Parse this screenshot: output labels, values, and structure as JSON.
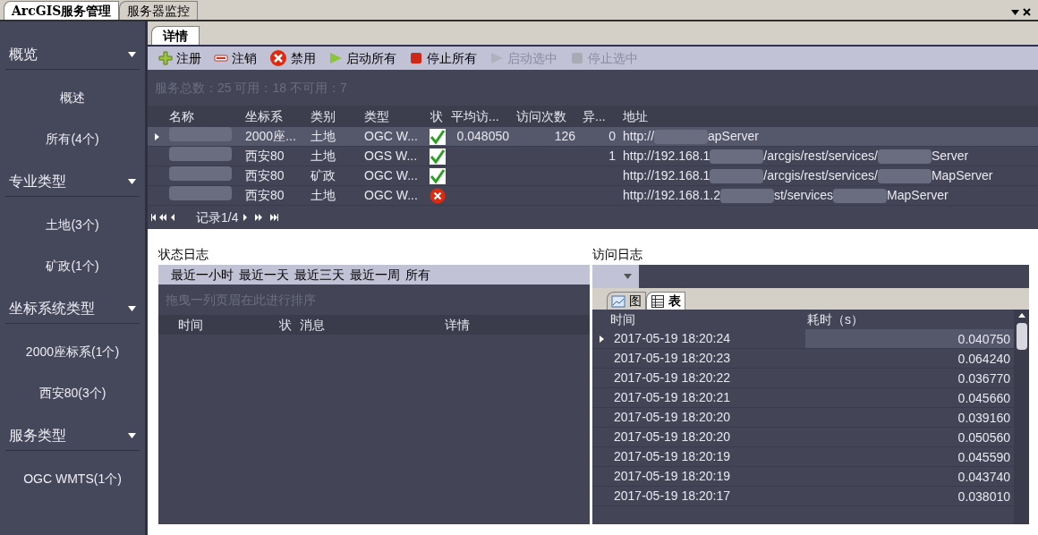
{
  "top_tabs": [
    {
      "label": "ArcGIS服务管理",
      "selected": true
    },
    {
      "label": "服务器监控",
      "selected": false
    }
  ],
  "sidebar": {
    "groups": [
      {
        "title": "概览",
        "items": [
          "概述",
          "所有(4个)"
        ]
      },
      {
        "title": "专业类型",
        "items": [
          "土地(3个)",
          "矿政(1个)"
        ]
      },
      {
        "title": "坐标系统类型",
        "items": [
          "2000座标系(1个)",
          "西安80(3个)"
        ]
      },
      {
        "title": "服务类型",
        "items": [
          "OGC WMTS(1个)"
        ]
      }
    ]
  },
  "detail_tab": {
    "label": "详情",
    "selected": true
  },
  "toolbar": [
    {
      "kind": "register",
      "label": "注册",
      "disabled": false
    },
    {
      "kind": "unregister",
      "label": "注销",
      "disabled": false
    },
    {
      "kind": "disable",
      "label": "禁用",
      "disabled": false
    },
    {
      "kind": "start",
      "label": "启动所有",
      "disabled": false
    },
    {
      "kind": "stop",
      "label": "停止所有",
      "disabled": false
    },
    {
      "kind": "start",
      "label": "启动选中",
      "disabled": true
    },
    {
      "kind": "stop",
      "label": "停止选中",
      "disabled": true
    }
  ],
  "summary": "服务总数：25 可用：18 不可用：7",
  "grid": {
    "columns": [
      "名称",
      "坐标系",
      "类别",
      "类型",
      "状",
      "平均访...",
      "访问次数",
      "异...",
      "地址"
    ],
    "rows": [
      {
        "selected": true,
        "coord": "2000座...",
        "category": "土地",
        "type": "OGC W...",
        "ok": true,
        "avg": "0.048050",
        "visits": "126",
        "errors": "0",
        "address": [
          "http://",
          "apServer"
        ]
      },
      {
        "selected": false,
        "coord": "西安80",
        "category": "土地",
        "type": "OGS W...",
        "ok": true,
        "avg": "",
        "visits": "",
        "errors": "1",
        "address": [
          "http://192.168.1",
          "/arcgis/rest/services/",
          "Server"
        ]
      },
      {
        "selected": false,
        "coord": "西安80",
        "category": "矿政",
        "type": "OGC W...",
        "ok": true,
        "avg": "",
        "visits": "",
        "errors": "",
        "address": [
          "http://192.168.1",
          "/arcgis/rest/services/",
          "MapServer"
        ]
      },
      {
        "selected": false,
        "coord": "西安80",
        "category": "土地",
        "type": "OGC W...",
        "ok": false,
        "avg": "",
        "visits": "",
        "errors": "",
        "address": [
          "http://192.168.1.2",
          "st/services",
          "MapServer"
        ]
      }
    ]
  },
  "pager": "记录1/4",
  "status_log": {
    "title": "状态日志",
    "filters": [
      "最近一小时",
      "最近一天",
      "最近三天",
      "最近一周",
      "所有"
    ],
    "group_hint": "拖曳一列页眉在此进行排序",
    "columns": [
      "时间",
      "状",
      "消息",
      "详情"
    ]
  },
  "access_log": {
    "title": "访问日志",
    "view_tabs": [
      {
        "kind": "chart",
        "label": "图",
        "selected": false
      },
      {
        "kind": "table",
        "label": "表",
        "selected": true
      }
    ],
    "columns": [
      "时间",
      "耗时（s）"
    ],
    "rows": [
      {
        "selected": true,
        "time": "2017-05-19 18:20:24",
        "duration": "0.040750"
      },
      {
        "selected": false,
        "time": "2017-05-19 18:20:23",
        "duration": "0.064240"
      },
      {
        "selected": false,
        "time": "2017-05-19 18:20:22",
        "duration": "0.036770"
      },
      {
        "selected": false,
        "time": "2017-05-19 18:20:21",
        "duration": "0.045660"
      },
      {
        "selected": false,
        "time": "2017-05-19 18:20:20",
        "duration": "0.039160"
      },
      {
        "selected": false,
        "time": "2017-05-19 18:20:20",
        "duration": "0.050560"
      },
      {
        "selected": false,
        "time": "2017-05-19 18:20:19",
        "duration": "0.045590"
      },
      {
        "selected": false,
        "time": "2017-05-19 18:20:19",
        "duration": "0.043740"
      },
      {
        "selected": false,
        "time": "2017-05-19 18:20:17",
        "duration": "0.038010"
      }
    ]
  }
}
